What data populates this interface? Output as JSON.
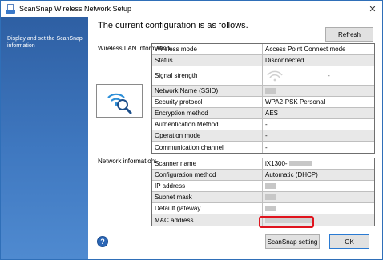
{
  "window": {
    "title": "ScanSnap Wireless Network Setup",
    "close_glyph": "✕"
  },
  "sidebar": {
    "description": "Display and set the ScanSnap information"
  },
  "main": {
    "heading": "The current configuration is as follows.",
    "refresh_label": "Refresh",
    "wlan_label": "Wireless LAN information:",
    "network_label": "Network information:",
    "wlan_rows": [
      {
        "key": "Wireless mode",
        "value": "Access Point Connect mode"
      },
      {
        "key": "Status",
        "value": "Disconnected"
      },
      {
        "key": "Signal strength",
        "value": "-"
      },
      {
        "key": "Network Name (SSID)",
        "value": ""
      },
      {
        "key": "Security protocol",
        "value": "WPA2-PSK Personal"
      },
      {
        "key": "Encryption method",
        "value": "AES"
      },
      {
        "key": "Authentication Method",
        "value": "-"
      },
      {
        "key": "Operation mode",
        "value": "-"
      },
      {
        "key": "Communication channel",
        "value": "-"
      }
    ],
    "network_rows": [
      {
        "key": "Scanner name",
        "value": "iX1300-"
      },
      {
        "key": "Configuration method",
        "value": "Automatic (DHCP)"
      },
      {
        "key": "IP address",
        "value": ""
      },
      {
        "key": "Subnet mask",
        "value": ""
      },
      {
        "key": "Default gateway",
        "value": ""
      },
      {
        "key": "MAC address",
        "value": ""
      }
    ]
  },
  "footer": {
    "help_glyph": "?",
    "scansnap_setting_label": "ScanSnap setting",
    "ok_label": "OK"
  },
  "colors": {
    "sidebar": "#3f78c0",
    "highlight": "#e0141e",
    "row_shade": "#e8e8e8"
  },
  "icons": {
    "app": "scansnap-app-icon",
    "wifi_search": "wifi-search-icon",
    "signal": "signal-strength-icon",
    "help": "help-icon",
    "close": "close-icon"
  }
}
